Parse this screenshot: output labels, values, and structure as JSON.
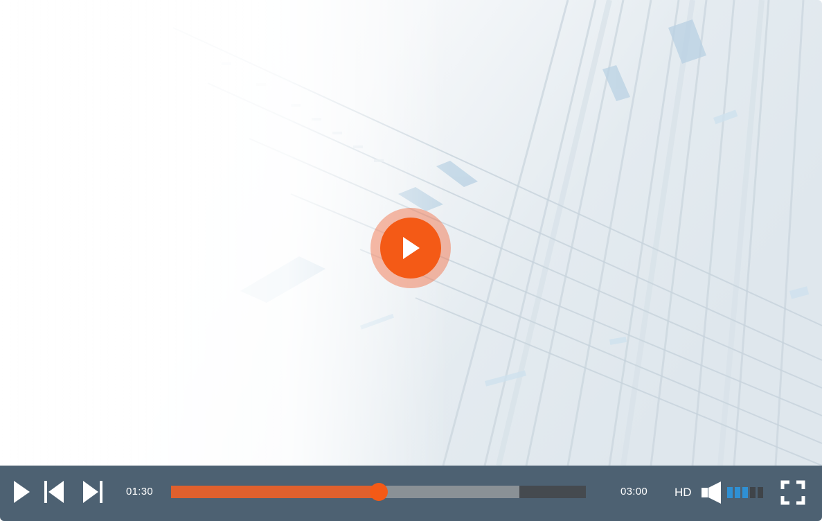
{
  "player": {
    "current_time": "01:30",
    "duration": "03:00",
    "quality_label": "HD",
    "progress_fraction": 0.5,
    "buffered_fraction": 0.84,
    "volume_level": 3,
    "volume_max": 5,
    "colors": {
      "accent": "#f45a16",
      "control_bar": "#4d6172",
      "played": "#e0602d",
      "buffered": "#8a9196",
      "track": "#454a4f",
      "volume_on": "#2f90d4",
      "volume_off": "#3f4449"
    },
    "icons": {
      "big_play": "play-icon",
      "play": "play-icon",
      "previous": "skip-previous-icon",
      "next": "skip-next-icon",
      "volume": "speaker-icon",
      "fullscreen": "fullscreen-icon"
    }
  }
}
